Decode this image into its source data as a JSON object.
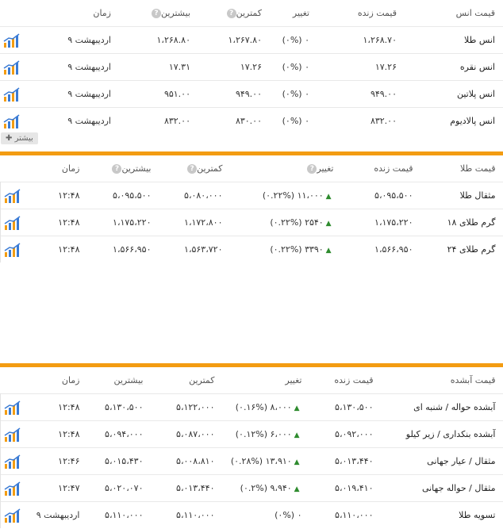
{
  "ounce": {
    "headers": {
      "name": "قیمت انس",
      "live": "قیمت زنده",
      "change": "تغییر",
      "low": "کمترین",
      "high": "بیشترین",
      "time": "زمان"
    },
    "rows": [
      {
        "name": "انس طلا",
        "live": "۱،۲۶۸.۷۰",
        "change": "(۰%) ۰",
        "low": "۱،۲۶۷.۸۰",
        "high": "۱،۲۶۸.۸۰",
        "time": "۹ اردیبهشت"
      },
      {
        "name": "انس نقره",
        "live": "۱۷.۲۶",
        "change": "(۰%) ۰",
        "low": "۱۷.۲۶",
        "high": "۱۷.۳۱",
        "time": "۹ اردیبهشت"
      },
      {
        "name": "انس پلاتین",
        "live": "۹۴۹.۰۰",
        "change": "(۰%) ۰",
        "low": "۹۴۹.۰۰",
        "high": "۹۵۱.۰۰",
        "time": "۹ اردیبهشت"
      },
      {
        "name": "انس پالادیوم",
        "live": "۸۳۲.۰۰",
        "change": "(۰%) ۰",
        "low": "۸۳۰.۰۰",
        "high": "۸۳۲.۰۰",
        "time": "۹ اردیبهشت"
      }
    ],
    "more_label": "بیشتر"
  },
  "gold": {
    "headers": {
      "name": "قیمت طلا",
      "live": "قیمت زنده",
      "change": "تغییر",
      "low": "کمترین",
      "high": "بیشترین",
      "time": "زمان"
    },
    "rows": [
      {
        "name": "مثقال طلا",
        "live": "۵،۰۹۵،۵۰۰",
        "change": "(۰.۲۲%) ۱۱،۰۰۰",
        "low": "۵،۰۸۰،۰۰۰",
        "high": "۵،۰۹۵،۵۰۰",
        "time": "۱۲:۴۸"
      },
      {
        "name": "گرم طلای ۱۸",
        "live": "۱،۱۷۵،۲۲۰",
        "change": "(۰.۲۲%) ۲۵۴۰",
        "low": "۱،۱۷۲،۸۰۰",
        "high": "۱،۱۷۵،۲۲۰",
        "time": "۱۲:۴۸"
      },
      {
        "name": "گرم طلای ۲۴",
        "live": "۱،۵۶۶،۹۵۰",
        "change": "(۰.۲۲%) ۳۳۹۰",
        "low": "۱،۵۶۳،۷۲۰",
        "high": "۱،۵۶۶،۹۵۰",
        "time": "۱۲:۴۸"
      }
    ]
  },
  "melted": {
    "headers": {
      "name": "قیمت آبشده",
      "live": "قیمت زنده",
      "change": "تغییر",
      "low": "کمترین",
      "high": "بیشترین",
      "time": "زمان"
    },
    "rows": [
      {
        "name": "آبشده حواله / شنبه ای",
        "live": "۵،۱۳۰،۵۰۰",
        "change": "(۰.۱۶%) ۸،۰۰۰",
        "low": "۵،۱۲۲،۰۰۰",
        "high": "۵،۱۳۰،۵۰۰",
        "time": "۱۲:۴۸"
      },
      {
        "name": "آبشده بنکداری / زیر کیلو",
        "live": "۵،۰۹۲،۰۰۰",
        "change": "(۰.۱۲%) ۶،۰۰۰",
        "low": "۵،۰۸۷،۰۰۰",
        "high": "۵،۰۹۴،۰۰۰",
        "time": "۱۲:۴۸"
      },
      {
        "name": "مثقال / عیار جهانی",
        "live": "۵،۰۱۳،۴۴۰",
        "change": "(۰.۲۸%) ۱۳،۹۱۰",
        "low": "۵،۰۰۸،۸۱۰",
        "high": "۵،۰۱۵،۴۳۰",
        "time": "۱۲:۴۶"
      },
      {
        "name": "مثقال / حواله جهانی",
        "live": "۵،۰۱۹،۴۱۰",
        "change": "(۰.۲%) ۹،۹۴۰",
        "low": "۵،۰۱۳،۴۴۰",
        "high": "۵،۰۲۰،۰۷۰",
        "time": "۱۲:۴۷"
      },
      {
        "name": "تسویه طلا",
        "live": "۵،۱۱۰،۰۰۰",
        "change": "(۰%) ۰",
        "low": "۵،۱۱۰،۰۰۰",
        "high": "۵،۱۱۰،۰۰۰",
        "time": "۹ اردیبهشت"
      }
    ]
  },
  "icons": {
    "chart": "bar-chart-trend-icon",
    "help": "question-circle-icon",
    "plus": "plus-icon",
    "up": "up-triangle-icon"
  },
  "colors": {
    "accent": "#f39c12",
    "positive": "#2e8b2e",
    "chart_blue": "#3a7bd5"
  }
}
